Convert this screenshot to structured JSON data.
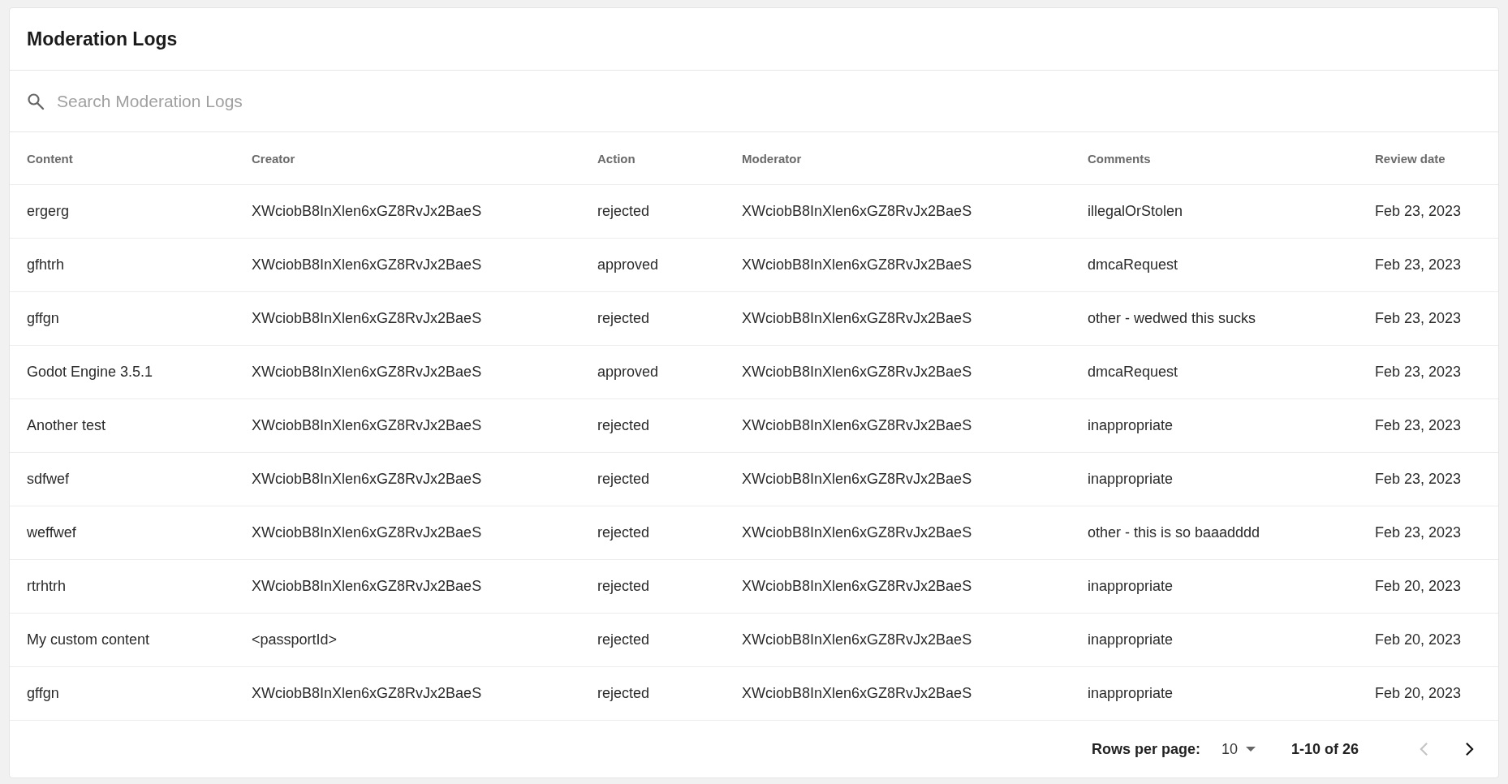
{
  "title": "Moderation Logs",
  "search": {
    "placeholder": "Search Moderation Logs"
  },
  "table": {
    "columns": [
      "Content",
      "Creator",
      "Action",
      "Moderator",
      "Comments",
      "Review date"
    ],
    "rows": [
      [
        "ergerg",
        "XWciobB8InXlen6xGZ8RvJx2BaeS",
        "rejected",
        "XWciobB8InXlen6xGZ8RvJx2BaeS",
        "illegalOrStolen",
        "Feb 23, 2023"
      ],
      [
        "gfhtrh",
        "XWciobB8InXlen6xGZ8RvJx2BaeS",
        "approved",
        "XWciobB8InXlen6xGZ8RvJx2BaeS",
        "dmcaRequest",
        "Feb 23, 2023"
      ],
      [
        "gffgn",
        "XWciobB8InXlen6xGZ8RvJx2BaeS",
        "rejected",
        "XWciobB8InXlen6xGZ8RvJx2BaeS",
        "other - wedwed this sucks",
        "Feb 23, 2023"
      ],
      [
        "Godot Engine 3.5.1",
        "XWciobB8InXlen6xGZ8RvJx2BaeS",
        "approved",
        "XWciobB8InXlen6xGZ8RvJx2BaeS",
        "dmcaRequest",
        "Feb 23, 2023"
      ],
      [
        "Another test",
        "XWciobB8InXlen6xGZ8RvJx2BaeS",
        "rejected",
        "XWciobB8InXlen6xGZ8RvJx2BaeS",
        "inappropriate",
        "Feb 23, 2023"
      ],
      [
        "sdfwef",
        "XWciobB8InXlen6xGZ8RvJx2BaeS",
        "rejected",
        "XWciobB8InXlen6xGZ8RvJx2BaeS",
        "inappropriate",
        "Feb 23, 2023"
      ],
      [
        "weffwef",
        "XWciobB8InXlen6xGZ8RvJx2BaeS",
        "rejected",
        "XWciobB8InXlen6xGZ8RvJx2BaeS",
        "other - this is so baaadddd",
        "Feb 23, 2023"
      ],
      [
        "rtrhtrh",
        "XWciobB8InXlen6xGZ8RvJx2BaeS",
        "rejected",
        "XWciobB8InXlen6xGZ8RvJx2BaeS",
        "inappropriate",
        "Feb 20, 2023"
      ],
      [
        "My custom content",
        "<passportId>",
        "rejected",
        "XWciobB8InXlen6xGZ8RvJx2BaeS",
        "inappropriate",
        "Feb 20, 2023"
      ],
      [
        "gffgn",
        "XWciobB8InXlen6xGZ8RvJx2BaeS",
        "rejected",
        "XWciobB8InXlen6xGZ8RvJx2BaeS",
        "inappropriate",
        "Feb 20, 2023"
      ]
    ]
  },
  "pagination": {
    "rows_per_page_label": "Rows per page:",
    "rows_per_page": "10",
    "range": "1-10 of 26",
    "previous": {
      "disabled": true
    },
    "next": {
      "disabled": false
    }
  }
}
